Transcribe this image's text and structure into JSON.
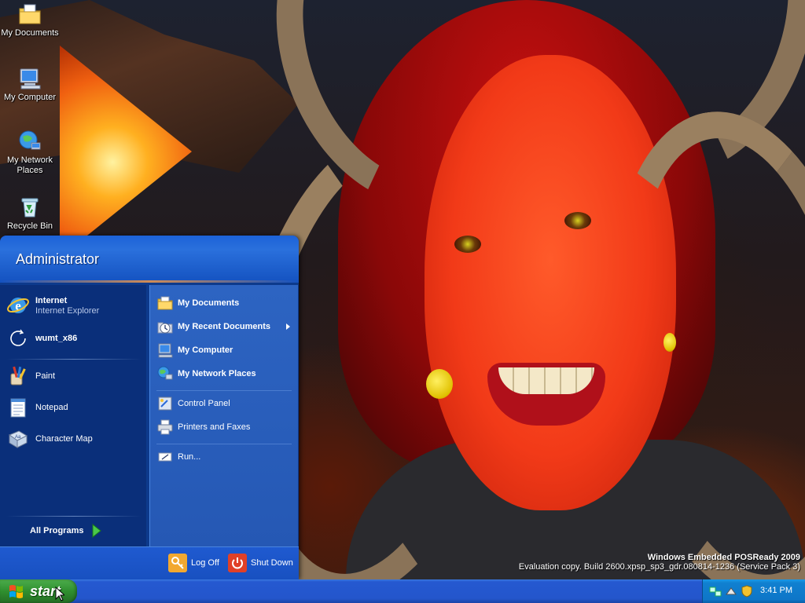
{
  "desktop": {
    "icons": [
      {
        "label": "My Documents",
        "icon": "folder-documents-icon"
      },
      {
        "label": "My Computer",
        "icon": "computer-icon"
      },
      {
        "label": "My Network Places",
        "icon": "network-places-icon"
      },
      {
        "label": "Recycle Bin",
        "icon": "recycle-bin-icon"
      }
    ]
  },
  "start_menu": {
    "user": "Administrator",
    "left": {
      "pinned": [
        {
          "title": "Internet",
          "subtitle": "Internet Explorer",
          "icon": "internet-explorer-icon"
        },
        {
          "title": "wumt_x86",
          "icon": "refresh-circle-icon"
        }
      ],
      "recent": [
        {
          "label": "Paint",
          "icon": "paint-icon"
        },
        {
          "label": "Notepad",
          "icon": "notepad-icon"
        },
        {
          "label": "Character Map",
          "icon": "character-map-icon"
        }
      ],
      "all_programs": "All Programs"
    },
    "right": {
      "places": [
        {
          "label": "My Documents",
          "icon": "folder-documents-icon"
        },
        {
          "label": "My Recent Documents",
          "icon": "recent-documents-icon",
          "has_submenu": true
        },
        {
          "label": "My Computer",
          "icon": "computer-icon"
        },
        {
          "label": "My Network Places",
          "icon": "network-places-icon"
        }
      ],
      "settings": [
        {
          "label": "Control Panel",
          "icon": "control-panel-icon"
        },
        {
          "label": "Printers and Faxes",
          "icon": "printer-icon"
        }
      ],
      "run": {
        "label": "Run...",
        "icon": "run-icon"
      }
    },
    "footer": {
      "log_off": "Log Off",
      "shut_down": "Shut Down"
    }
  },
  "watermark": {
    "title": "Windows Embedded POSReady 2009",
    "build": "Evaluation copy. Build 2600.xpsp_sp3_gdr.080814-1236 (Service Pack 3)"
  },
  "taskbar": {
    "start_label": "start",
    "clock": "3:41 PM"
  },
  "colors": {
    "start_menu_blue": "#2558b4",
    "taskbar_blue": "#2456cc",
    "start_green": "#2f8f2f",
    "tray_blue": "#0e76c8"
  }
}
